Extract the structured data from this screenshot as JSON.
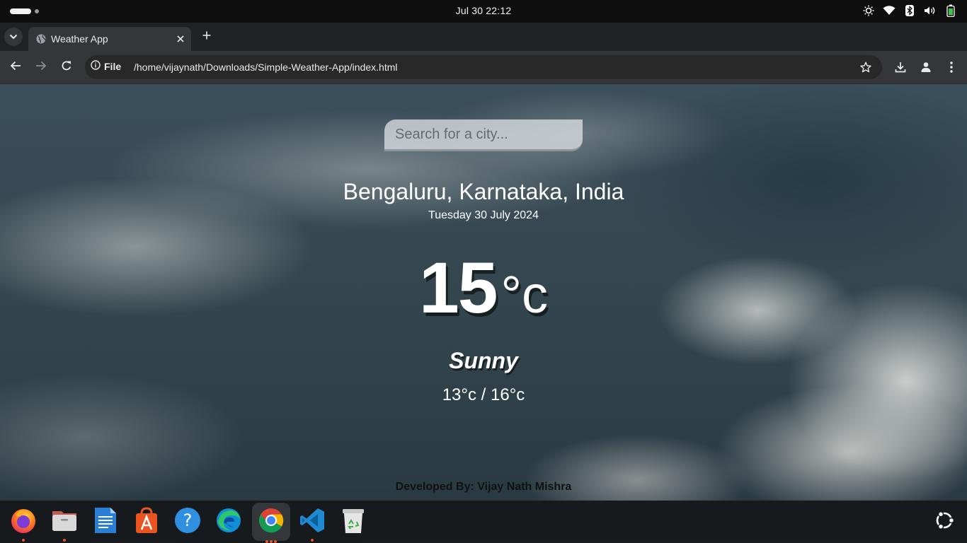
{
  "system": {
    "clock": "Jul 30  22:12",
    "tray_icons": [
      "brightness-icon",
      "wifi-icon",
      "bluetooth-icon",
      "volume-icon",
      "battery-icon"
    ]
  },
  "browser": {
    "tab": {
      "title": "Weather App"
    },
    "address": {
      "scheme_label": "File",
      "url": "/home/vijaynath/Downloads/Simple-Weather-App/index.html"
    }
  },
  "page": {
    "search": {
      "placeholder": "Search for a city..."
    },
    "city": "Bengaluru, Karnataka, India",
    "date": "Tuesday 30 July 2024",
    "temperature": {
      "value": "15",
      "unit": "°c"
    },
    "condition": "Sunny",
    "hi_low": "13°c / 16°c",
    "footer": "Developed By: Vijay Nath Mishra"
  },
  "dock": {
    "apps": [
      "Firefox",
      "Files",
      "LibreOffice Writer",
      "App Center",
      "Help",
      "Microsoft Edge",
      "Google Chrome",
      "Visual Studio Code",
      "Trash"
    ],
    "active_app": "Google Chrome",
    "accent": "#e95420"
  }
}
